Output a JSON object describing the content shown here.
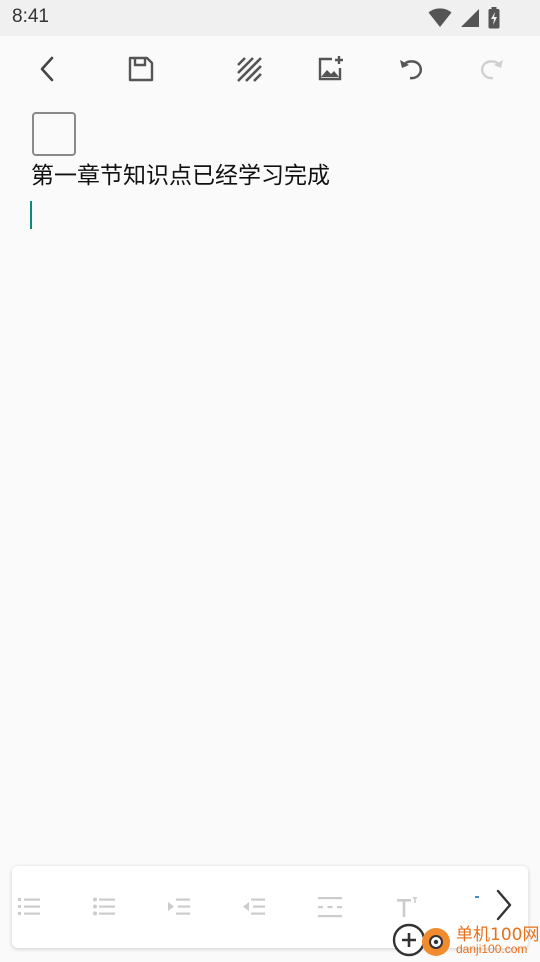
{
  "status_bar": {
    "time": "8:41",
    "icons": [
      "wifi-icon",
      "cell-signal-icon",
      "battery-charging-icon"
    ]
  },
  "toolbar": {
    "buttons": [
      {
        "name": "back-button",
        "icon": "chevron-left-icon",
        "enabled": true
      },
      {
        "name": "save-button",
        "icon": "save-icon",
        "enabled": true
      },
      {
        "name": "background-pattern-button",
        "icon": "hatch-pattern-icon",
        "enabled": true
      },
      {
        "name": "insert-image-button",
        "icon": "add-image-icon",
        "enabled": true
      },
      {
        "name": "undo-button",
        "icon": "undo-icon",
        "enabled": true
      },
      {
        "name": "redo-button",
        "icon": "redo-icon",
        "enabled": false
      }
    ]
  },
  "editor": {
    "checkbox_checked": false,
    "text": "第一章节知识点已经学习完成"
  },
  "format_bar": {
    "buttons": [
      {
        "name": "numbered-list-button",
        "icon": "numbered-list-icon"
      },
      {
        "name": "bullet-list-button",
        "icon": "bullet-list-icon"
      },
      {
        "name": "indent-button",
        "icon": "indent-icon"
      },
      {
        "name": "outdent-button",
        "icon": "outdent-icon"
      },
      {
        "name": "horizontal-rule-button",
        "icon": "horizontal-rule-icon"
      },
      {
        "name": "superscript-button",
        "icon": "superscript-icon"
      }
    ],
    "next_icon": "chevron-right-icon"
  },
  "watermark": {
    "title": "单机100网",
    "url": "danji100.com"
  },
  "colors": {
    "background": "#fafafa",
    "cursor": "#0f8a7a",
    "icon": "#555555",
    "icon_disabled": "#cfcfcf",
    "format_icon": "#cccccc",
    "watermark": "#e8701a"
  }
}
